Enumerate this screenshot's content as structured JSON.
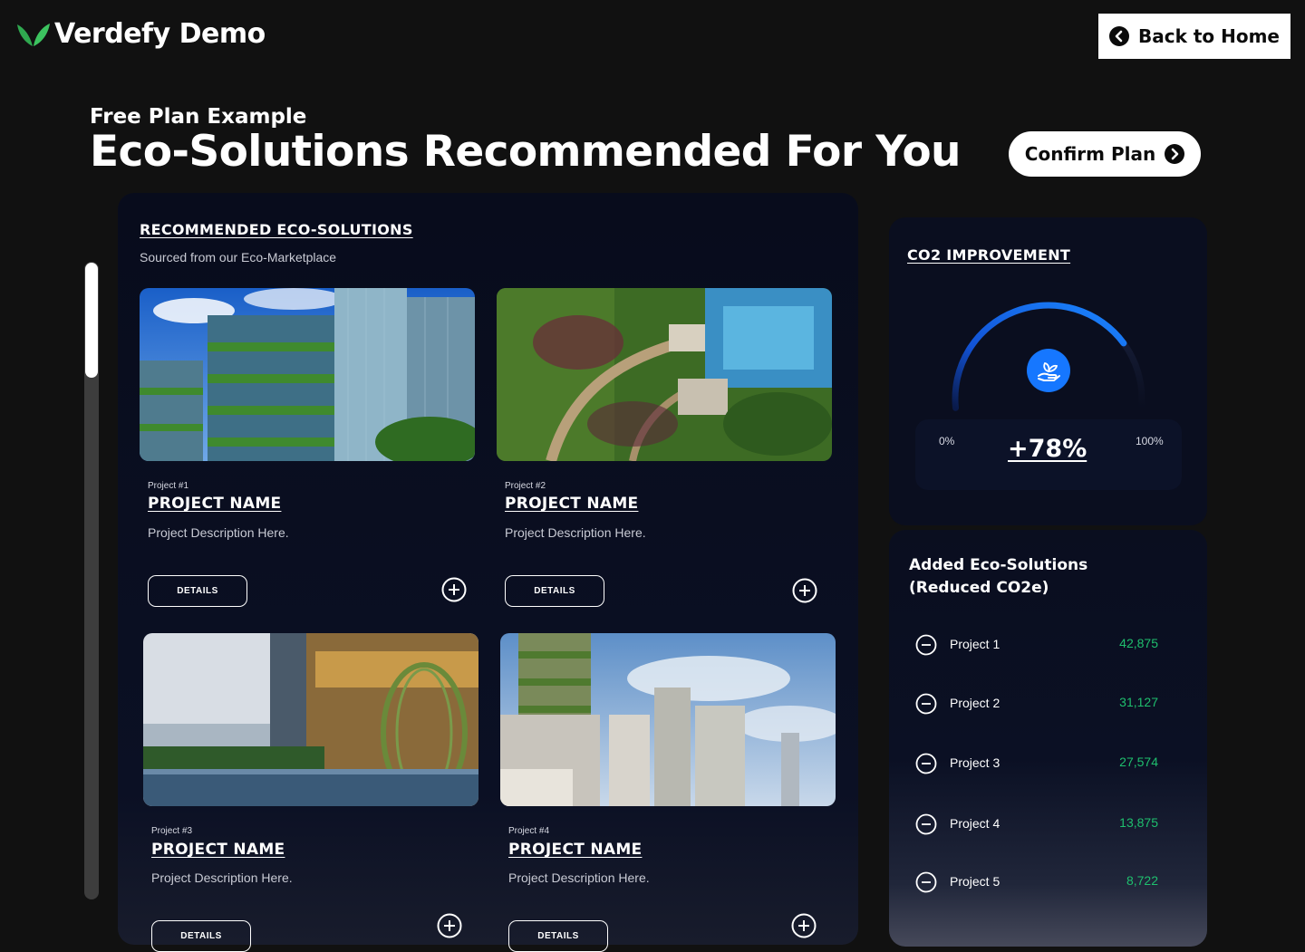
{
  "header": {
    "brand": "Verdefy Demo",
    "back_label": "Back to Home"
  },
  "hero": {
    "pre_title": "Free Plan Example",
    "title": "Eco-Solutions Recommended For You",
    "confirm_label": "Confirm Plan"
  },
  "recommended": {
    "title": "RECOMMENDED ECO-SOLUTIONS",
    "subtitle": "Sourced from our Eco-Marketplace",
    "cards": [
      {
        "number": "Project #1",
        "name": "PROJECT NAME",
        "description": "Project Description Here.",
        "details_label": "DETAILS"
      },
      {
        "number": "Project #2",
        "name": "PROJECT NAME",
        "description": "Project Description Here.",
        "details_label": "DETAILS"
      },
      {
        "number": "Project #3",
        "name": "PROJECT NAME",
        "description": "Project Description Here.",
        "details_label": "DETAILS"
      },
      {
        "number": "Project #4",
        "name": "PROJECT NAME",
        "description": "Project Description Here.",
        "details_label": "DETAILS"
      }
    ]
  },
  "co2": {
    "title": "CO2 IMPROVEMENT",
    "min_label": "0%",
    "max_label": "100%",
    "value_label": "+78%",
    "value": 0.78,
    "icon": "hand-plant-icon"
  },
  "added": {
    "title_line1": "Added Eco-Solutions",
    "title_line2": "(Reduced CO2e)",
    "items": [
      {
        "name": "Project 1",
        "value": "42,875"
      },
      {
        "name": "Project 2",
        "value": "31,127"
      },
      {
        "name": "Project 3",
        "value": "27,574"
      },
      {
        "name": "Project 4",
        "value": "13,875"
      },
      {
        "name": "Project 5",
        "value": "8,722"
      }
    ]
  },
  "colors": {
    "background": "#111111",
    "panel": "#0a0e1f",
    "accent_blue": "#1677ff",
    "value_green": "#1fbf6e",
    "brand_green": "#2fa84f"
  }
}
